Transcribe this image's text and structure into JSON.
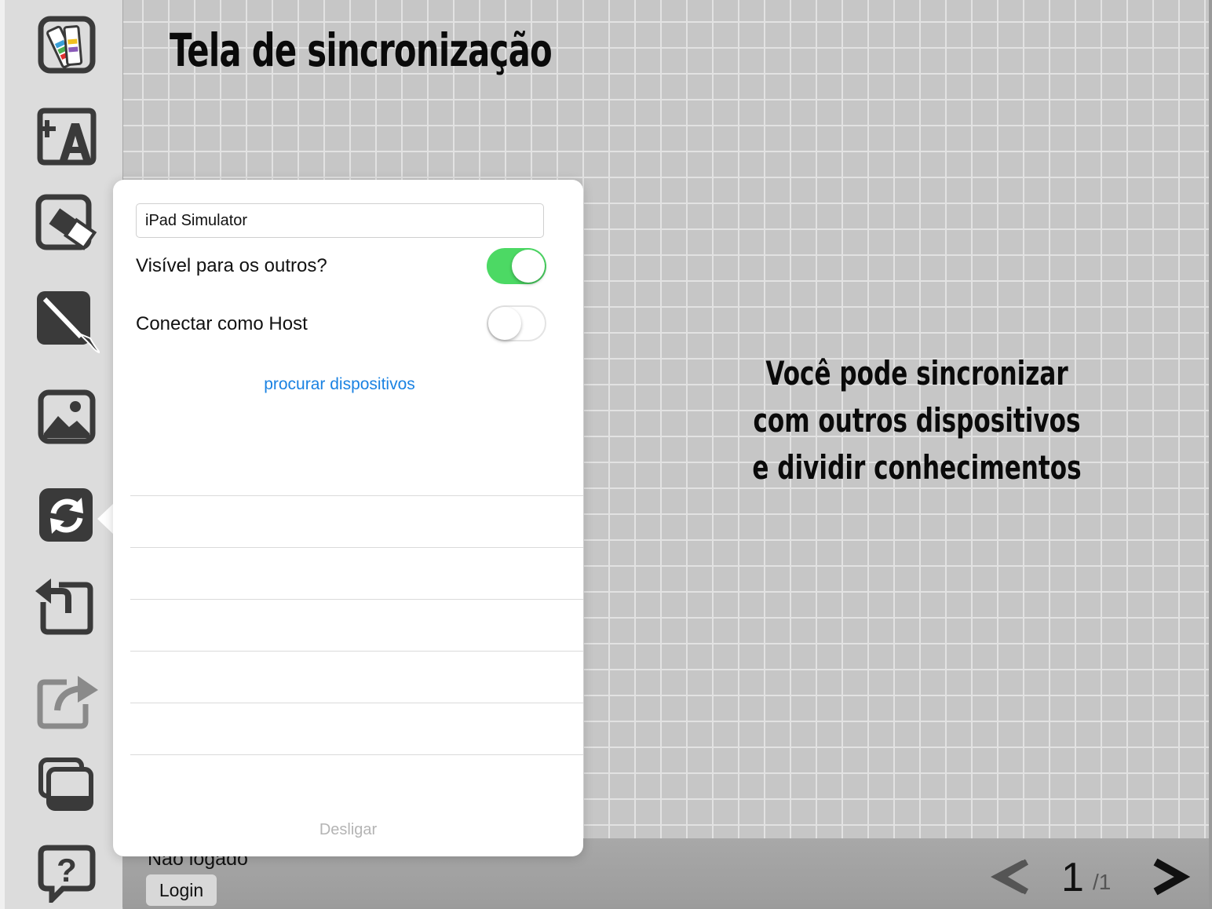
{
  "title": "Tela de sincronização",
  "description": "Você pode sincronizar com outros dispositivos e dividir conhecimentos",
  "sidebar": {
    "tools": [
      {
        "name": "palette-tool",
        "icon": "color-palette-icon"
      },
      {
        "name": "add-text-tool",
        "icon": "add-text-icon"
      },
      {
        "name": "eraser-tool",
        "icon": "eraser-icon"
      },
      {
        "name": "brush-tool",
        "icon": "paintbrush-icon"
      },
      {
        "name": "image-tool",
        "icon": "image-icon"
      },
      {
        "name": "sync-tool",
        "icon": "sync-icon"
      },
      {
        "name": "undo-tool",
        "icon": "undo-icon"
      },
      {
        "name": "share-tool",
        "icon": "share-icon"
      },
      {
        "name": "pages-tool",
        "icon": "pages-icon"
      },
      {
        "name": "help-tool",
        "icon": "help-icon"
      }
    ]
  },
  "sync_popover": {
    "device_name": "iPad Simulator",
    "visible_label": "Visível para os outros?",
    "visible_on": true,
    "host_label": "Conectar como Host",
    "host_on": false,
    "search_link": "procurar dispositivos",
    "device_rows": 5,
    "disconnect_label": "Desligar"
  },
  "footer": {
    "login_status": "Não logado",
    "login_button": "Login",
    "page_current": "1",
    "page_total": "/1"
  },
  "colors": {
    "toggle_on": "#4cd964",
    "link": "#1a82e2",
    "icon_dark": "#3a3a3a"
  }
}
